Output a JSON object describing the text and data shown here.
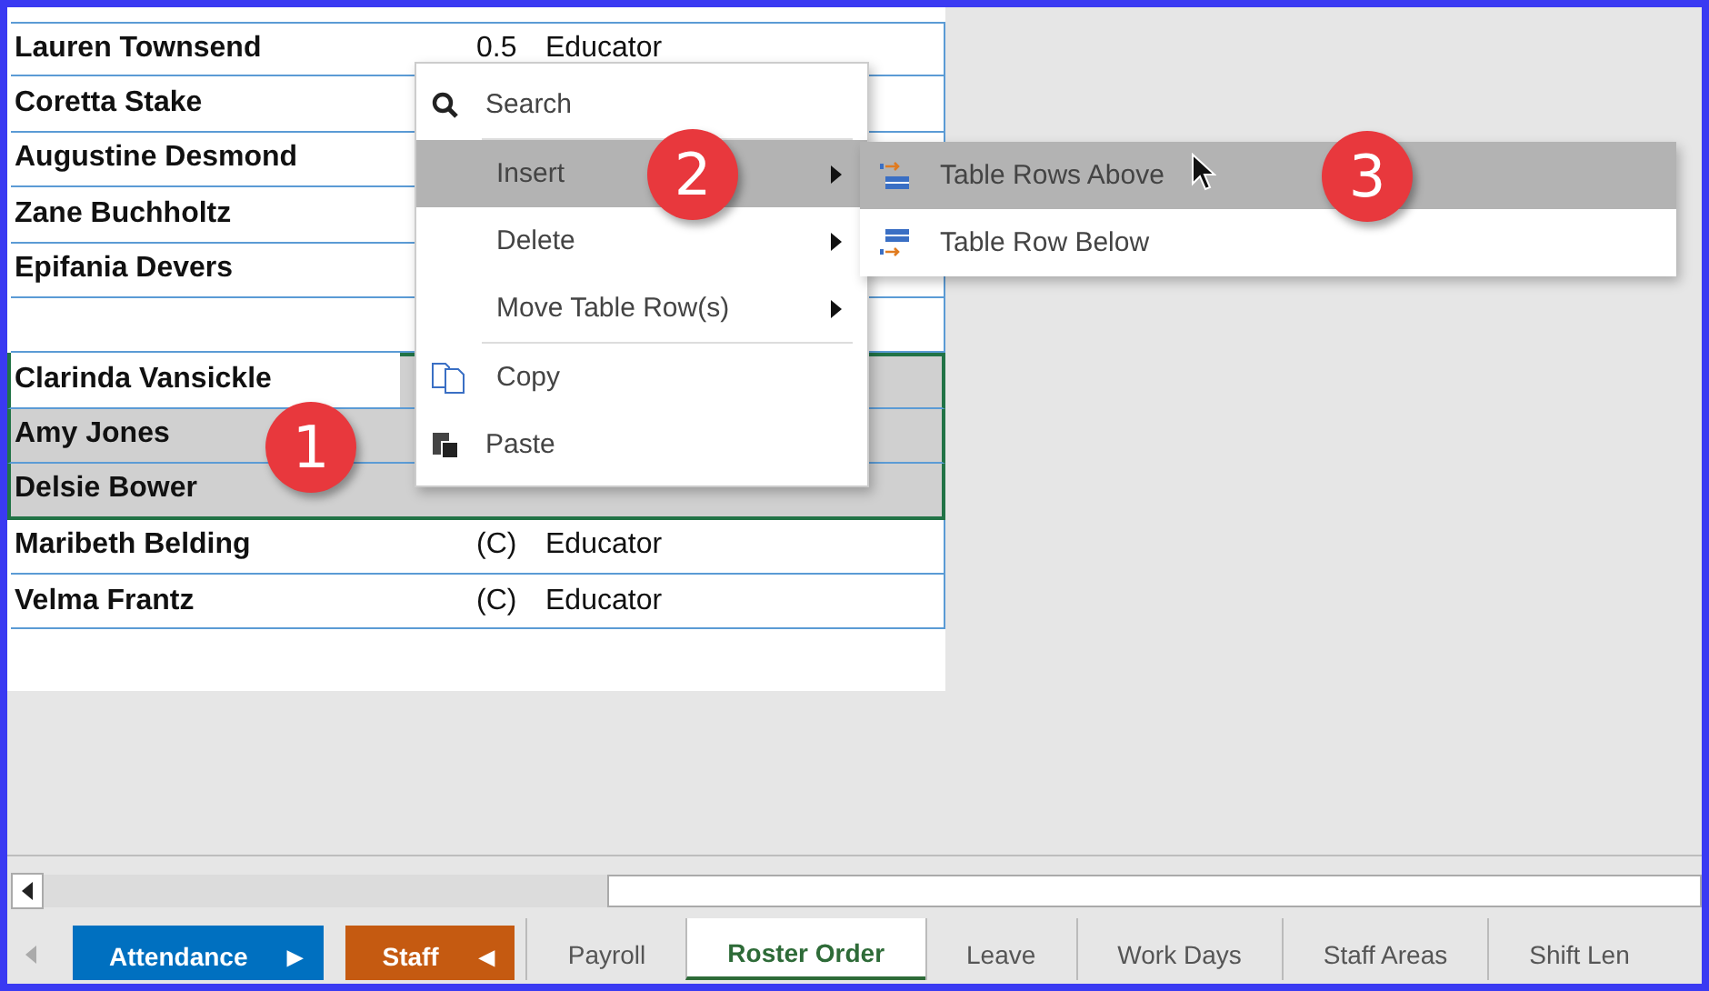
{
  "rows": [
    {
      "name": "Lauren Townsend",
      "col2": "0.5",
      "col3": "Educator",
      "selected": false
    },
    {
      "name": "Coretta Stake",
      "selected": false
    },
    {
      "name": "Augustine Desmond",
      "selected": false
    },
    {
      "name": "Zane Buchholtz",
      "selected": false
    },
    {
      "name": "Epifania Devers",
      "selected": false
    },
    {
      "selected": false
    },
    {
      "name": "Clarinda Vansickle",
      "selected": true
    },
    {
      "name": "Amy Jones",
      "selected": true,
      "badge": "1"
    },
    {
      "name": "Delsie Bower",
      "selected": true
    },
    {
      "name": "Maribeth Belding",
      "col2": "(C)",
      "col3": "Educator",
      "selected": false
    },
    {
      "name": "Velma Frantz",
      "col2": "(C)",
      "col3": "Educator",
      "selected": false
    }
  ],
  "context_menu": {
    "items": [
      {
        "kind": "search",
        "label": "Search",
        "submenu": false,
        "selected": false
      },
      {
        "kind": "separator"
      },
      {
        "kind": "plain",
        "label": "Insert",
        "submenu": true,
        "selected": true,
        "badge": "2"
      },
      {
        "kind": "plain",
        "label": "Delete",
        "submenu": true,
        "selected": false
      },
      {
        "kind": "plain",
        "label": "Move Table Row(s)",
        "submenu": true,
        "selected": false
      },
      {
        "kind": "separator"
      },
      {
        "kind": "copy",
        "label": "Copy",
        "submenu": false,
        "selected": false
      },
      {
        "kind": "paste",
        "label": "Paste",
        "submenu": false,
        "selected": false
      }
    ]
  },
  "submenu": {
    "items": [
      {
        "label": "Table Rows Above",
        "selected": true,
        "badge": "3"
      },
      {
        "label": "Table Row Below",
        "selected": false
      }
    ]
  },
  "sheet_tabs": [
    {
      "label": "Attendance",
      "selected": false,
      "color": "#0070c0",
      "arrow": "▶"
    },
    {
      "label": "Staff",
      "selected": false,
      "color": "#c55a11",
      "arrow": "◀"
    },
    {
      "label": "Payroll",
      "selected": false
    },
    {
      "label": "Roster Order",
      "selected": true
    },
    {
      "label": "Leave",
      "selected": false
    },
    {
      "label": "Work Days",
      "selected": false
    },
    {
      "label": "Staff Areas",
      "selected": false
    },
    {
      "label": "Shift Len",
      "selected": false
    }
  ]
}
